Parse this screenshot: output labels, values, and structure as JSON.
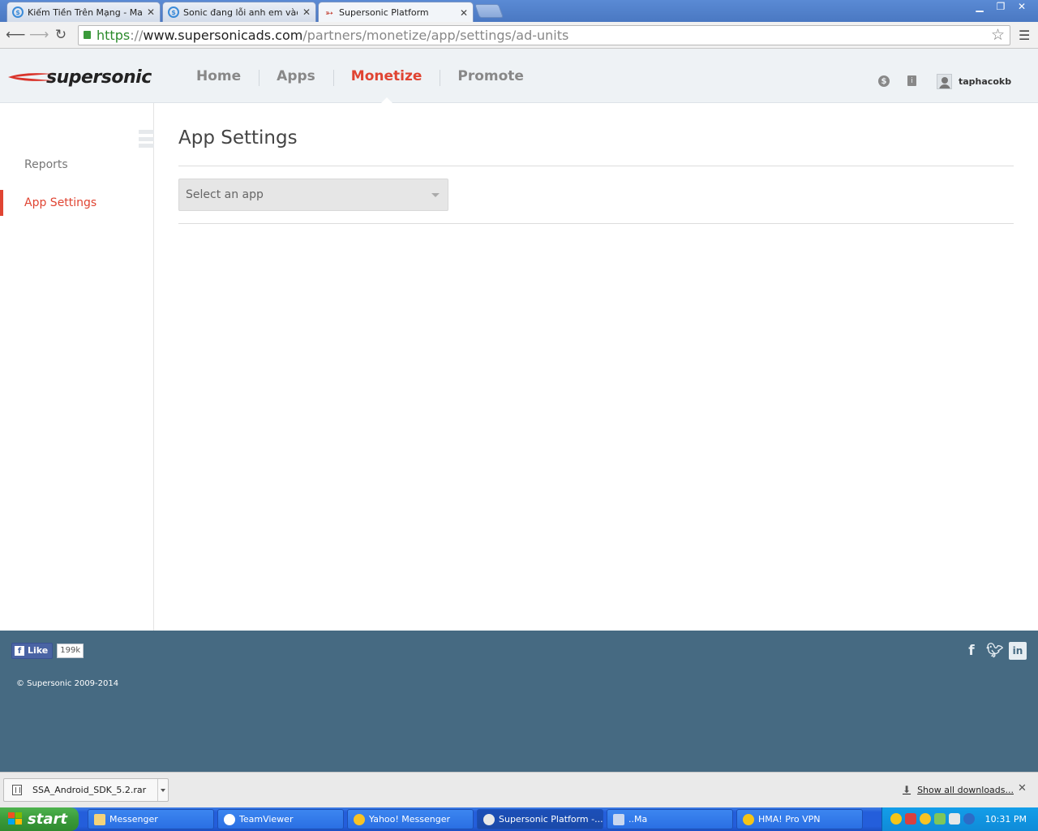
{
  "browser": {
    "tabs": [
      {
        "title": "Kiếm Tiền Trên Mạng - Make",
        "active": false
      },
      {
        "title": "Sonic đang lỗi anh em vào re",
        "active": false
      },
      {
        "title": "Supersonic Platform",
        "active": true
      }
    ],
    "url": {
      "scheme": "https",
      "separator": "://",
      "host": "www.supersonicads.com",
      "path": "/partners/monetize/app/settings/ad-units"
    }
  },
  "site": {
    "logo_text": "supersonic",
    "nav": [
      {
        "label": "Home",
        "active": false
      },
      {
        "label": "Apps",
        "active": false
      },
      {
        "label": "Monetize",
        "active": true
      },
      {
        "label": "Promote",
        "active": false
      }
    ],
    "header_icons": {
      "dollar": "$",
      "book": "i"
    },
    "username": "taphacokb",
    "accent_color": "#e04432"
  },
  "sidebar": {
    "items": [
      {
        "label": "Reports",
        "active": false
      },
      {
        "label": "App Settings",
        "active": true
      }
    ]
  },
  "main": {
    "title": "App Settings",
    "app_select": {
      "placeholder": "Select an app"
    }
  },
  "footer": {
    "like_label": "Like",
    "like_count": "199k",
    "copyright": "© Supersonic 2009-2014",
    "background_color": "#466a82"
  },
  "downloads": {
    "file": "SSA_Android_SDK_5.2.rar",
    "show_all": "Show all downloads..."
  },
  "taskbar": {
    "start_label": "start",
    "tasks": [
      {
        "label": "Messenger",
        "active": false
      },
      {
        "label": "TeamViewer",
        "active": false
      },
      {
        "label": "Yahoo! Messenger",
        "active": false
      },
      {
        "label": "Supersonic Platform -...",
        "active": true
      },
      {
        "label": "..Ma",
        "active": false
      },
      {
        "label": "HMA! Pro VPN",
        "active": false
      }
    ],
    "clock": "10:31 PM"
  }
}
